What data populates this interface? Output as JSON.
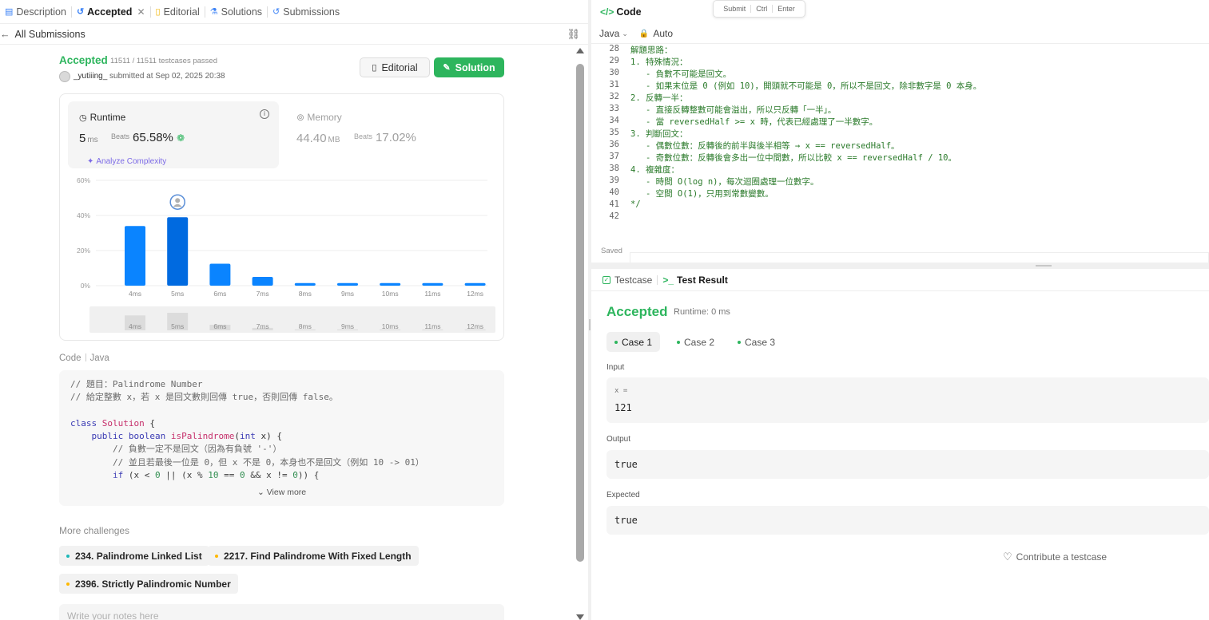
{
  "left_tabs": [
    {
      "label": "Description",
      "icon": "description-icon"
    },
    {
      "label": "Accepted",
      "icon": "history-icon"
    },
    {
      "label": "Editorial",
      "icon": "book-icon"
    },
    {
      "label": "Solutions",
      "icon": "flask-icon"
    },
    {
      "label": "Submissions",
      "icon": "history-icon"
    }
  ],
  "all_submissions": "All Submissions",
  "result": {
    "status": "Accepted",
    "cases_passed": "11511 / 11511 testcases passed",
    "user": "_yutiiing_",
    "submitted_at": "submitted at Sep 02, 2025 20:38"
  },
  "buttons": {
    "editorial": "Editorial",
    "solution": "Solution"
  },
  "runtime": {
    "label": "Runtime",
    "value": "5",
    "unit": "ms",
    "beats_label": "Beats",
    "beats_value": "65.58%",
    "analyze": "Analyze Complexity"
  },
  "memory": {
    "label": "Memory",
    "value": "44.40",
    "unit": "MB",
    "beats_label": "Beats",
    "beats_value": "17.02%"
  },
  "chart_data": {
    "type": "bar",
    "categories": [
      "4ms",
      "5ms",
      "6ms",
      "7ms",
      "8ms",
      "9ms",
      "10ms",
      "11ms",
      "12ms"
    ],
    "values": [
      34,
      39,
      12.5,
      5,
      1.5,
      1.5,
      1.5,
      1.5,
      1.5
    ],
    "highlight_index": 1,
    "yticks": [
      "0%",
      "20%",
      "40%",
      "60%"
    ],
    "ylim": [
      0,
      60
    ],
    "color": "#0a84ff",
    "highlight_color": "#006ae0"
  },
  "code_section": {
    "label": "Code",
    "language": "Java",
    "view_more": "View more"
  },
  "more_challenges": {
    "title": "More challenges",
    "items": [
      {
        "label": "234. Palindrome Linked List",
        "color": "#1cb8b8"
      },
      {
        "label": "2217. Find Palindrome With Fixed Length",
        "color": "#ffb800"
      },
      {
        "label": "2396. Strictly Palindromic Number",
        "color": "#ffb800"
      }
    ]
  },
  "notes_placeholder": "Write your notes here",
  "right": {
    "code_tab": "Code",
    "tooltip": [
      "Submit",
      "Ctrl",
      "Enter"
    ],
    "language": "Java",
    "auto": "Auto",
    "saved": "Saved"
  },
  "editor_lines": [
    {
      "n": "28",
      "t": "解題思路："
    },
    {
      "n": "29",
      "t": "1. 特殊情況："
    },
    {
      "n": "30",
      "t": "   - 負數不可能是回文。"
    },
    {
      "n": "31",
      "t": "   - 如果末位是 0 (例如 10)，開頭就不可能是 0，所以不是回文，除非數字是 0 本身。"
    },
    {
      "n": "32",
      "t": "2. 反轉一半："
    },
    {
      "n": "33",
      "t": "   - 直接反轉整數可能會溢出，所以只反轉「一半」。"
    },
    {
      "n": "34",
      "t": "   - 當 reversedHalf >= x 時，代表已經處理了一半數字。"
    },
    {
      "n": "35",
      "t": "3. 判斷回文："
    },
    {
      "n": "36",
      "t": "   - 偶數位數：反轉後的前半與後半相等 → x == reversedHalf。"
    },
    {
      "n": "37",
      "t": "   - 奇數位數：反轉後會多出一位中間數，所以比較 x == reversedHalf / 10。"
    },
    {
      "n": "38",
      "t": "4. 複雜度："
    },
    {
      "n": "39",
      "t": "   - 時間 O(log n)，每次迴圈處理一位數字。"
    },
    {
      "n": "40",
      "t": "   - 空間 O(1)，只用到常數變數。"
    },
    {
      "n": "41",
      "t": "*/"
    },
    {
      "n": "42",
      "t": ""
    }
  ],
  "test_result": {
    "testcase_tab": "Testcase",
    "result_tab": "Test Result",
    "status": "Accepted",
    "runtime": "Runtime: 0 ms",
    "cases": [
      "Case 1",
      "Case 2",
      "Case 3"
    ],
    "input_label": "Input",
    "input_var": "x =",
    "input_value": "121",
    "output_label": "Output",
    "output_value": "true",
    "expected_label": "Expected",
    "expected_value": "true",
    "contribute": "Contribute a testcase"
  }
}
